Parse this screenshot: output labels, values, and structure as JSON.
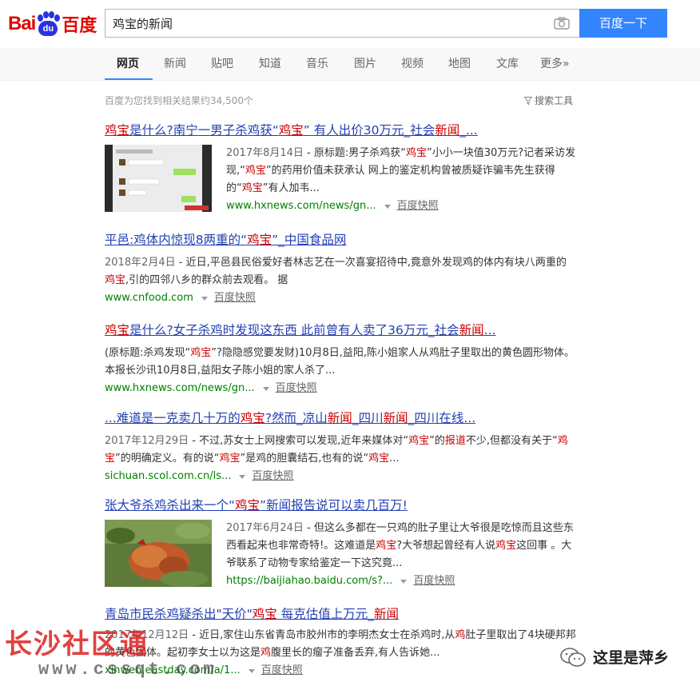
{
  "logo": {
    "part1": "Bai",
    "paw": "du",
    "part2": "百度"
  },
  "search": {
    "value": "鸡宝的新闻",
    "button": "百度一下"
  },
  "nav": {
    "tabs": [
      "网页",
      "新闻",
      "贴吧",
      "知道",
      "音乐",
      "图片",
      "视频",
      "地图",
      "文库",
      "更多»"
    ],
    "active": 0
  },
  "results_meta": {
    "count_text": "百度为您找到相关结果约34,500个",
    "tools_label": "搜索工具"
  },
  "results": [
    {
      "title_parts": [
        [
          "鸡宝",
          1
        ],
        [
          "是什么?南宁一男子杀鸡获“",
          0
        ],
        [
          "鸡宝",
          1
        ],
        [
          "” 有人出价30万元_社会",
          0
        ],
        [
          "新闻",
          1
        ],
        [
          "_...",
          0
        ]
      ],
      "date": "2017年8月14日",
      "abstract_parts": [
        [
          " - 原标题:男子杀鸡获“",
          0
        ],
        [
          "鸡宝",
          1
        ],
        [
          "”小小一块值30万元?记者采访发现,“",
          0
        ],
        [
          "鸡宝",
          1
        ],
        [
          "”的药用价值未获承认 网上的鉴定机构曾被质疑诈骗韦先生获得的“",
          0
        ],
        [
          "鸡宝",
          1
        ],
        [
          "”有人加韦...",
          0
        ]
      ],
      "url": "www.hxnews.com/news/gn...",
      "cache": "百度快照",
      "thumb": "chat"
    },
    {
      "title_parts": [
        [
          "平邑:鸡体内惊现8两重的“",
          0
        ],
        [
          "鸡宝",
          1
        ],
        [
          "”_中国食品网",
          0
        ]
      ],
      "date": "2018年2月4日",
      "abstract_parts": [
        [
          " - 近日,平邑县民俗爱好者林志艺在一次喜宴招待中,竟意外发现鸡的体内有块八两重的",
          0
        ],
        [
          "鸡宝",
          1
        ],
        [
          ",引的四邻八乡的群众前去观看。 据",
          0
        ]
      ],
      "url": "www.cnfood.com",
      "cache": "百度快照",
      "thumb": ""
    },
    {
      "title_parts": [
        [
          "鸡宝",
          1
        ],
        [
          "是什么?女子杀鸡时发现这东西 此前曾有人卖了36万元_社会",
          0
        ],
        [
          "新闻",
          1
        ],
        [
          "...",
          0
        ]
      ],
      "date": "",
      "abstract_parts": [
        [
          "(原标题:杀鸡发现“",
          0
        ],
        [
          "鸡宝",
          1
        ],
        [
          "”?隐隐感觉要发财)10月8日,益阳,陈小姐家人从鸡肚子里取出的黄色圆形物体。本报长沙讯10月8日,益阳女子陈小姐的家人杀了...",
          0
        ]
      ],
      "url": "www.hxnews.com/news/gn...",
      "cache": "百度快照",
      "thumb": ""
    },
    {
      "title_parts": [
        [
          "...难道是一克卖几十万的",
          0
        ],
        [
          "鸡宝",
          1
        ],
        [
          "?然而_凉山",
          0
        ],
        [
          "新闻",
          1
        ],
        [
          "_四川",
          0
        ],
        [
          "新闻",
          1
        ],
        [
          "_四川在线...",
          0
        ]
      ],
      "date": "2017年12月29日",
      "abstract_parts": [
        [
          " - 不过,苏女士上网搜索可以发现,近年来媒体对“",
          0
        ],
        [
          "鸡宝",
          1
        ],
        [
          "”的",
          0
        ],
        [
          "报道",
          1
        ],
        [
          "不少,但都没有关于“",
          0
        ],
        [
          "鸡宝",
          1
        ],
        [
          "”的明确定义。有的说“",
          0
        ],
        [
          "鸡宝",
          1
        ],
        [
          "”是鸡的胆囊结石,也有的说“",
          0
        ],
        [
          "鸡宝",
          1
        ],
        [
          "...",
          0
        ]
      ],
      "url": "sichuan.scol.com.cn/ls...",
      "cache": "百度快照",
      "thumb": ""
    },
    {
      "title_parts": [
        [
          "张大爷杀鸡杀出来一个“",
          0
        ],
        [
          "鸡宝",
          1
        ],
        [
          "”新闻报告说可以卖几百万!",
          0
        ]
      ],
      "date": "2017年6月24日",
      "abstract_parts": [
        [
          " - 但这么多都在一只鸡的肚子里让大爷很是吃惊而且这些东西看起来也非常奇特!。这难道是",
          0
        ],
        [
          "鸡宝",
          1
        ],
        [
          "?大爷想起曾经有人说",
          0
        ],
        [
          "鸡宝",
          1
        ],
        [
          "这回事 。大爷联系了动物专家给鉴定一下这究竟...",
          0
        ]
      ],
      "url": "https://baijiahao.baidu.com/s?...",
      "cache": "百度快照",
      "thumb": "chicken"
    },
    {
      "title_parts": [
        [
          "青岛市民杀鸡疑杀出\"天价\"",
          0
        ],
        [
          "鸡宝",
          1
        ],
        [
          " 每克估值上万元_",
          0
        ],
        [
          "新闻",
          1
        ]
      ],
      "date": "2017年12月12日",
      "abstract_parts": [
        [
          " - 近日,家住山东省青岛市胶州市的李明杰女士在杀鸡时,从",
          0
        ],
        [
          "鸡",
          1
        ],
        [
          "肚子里取出了4块硬邦邦的黄色固体。起初李女士以为这是",
          0
        ],
        [
          "鸡",
          1
        ],
        [
          "腹里长的瘤子准备丢弃,有人告诉她...",
          0
        ]
      ],
      "url": "xinwen.eastday.com/a/1...",
      "cache": "百度快照",
      "thumb": ""
    }
  ],
  "watermarks": {
    "left_big": "长沙社区通",
    "left_small": "www.cssqt.com",
    "right": "这里是萍乡"
  },
  "colors": {
    "brand_red": "#e10601",
    "brand_blue": "#2932e1",
    "button_blue": "#3385ff",
    "link": "#2440b3",
    "highlight": "#c00",
    "url_green": "#008000"
  },
  "icons": [
    "camera-icon",
    "funnel-icon",
    "caret-down-icon",
    "wechat-icon"
  ]
}
